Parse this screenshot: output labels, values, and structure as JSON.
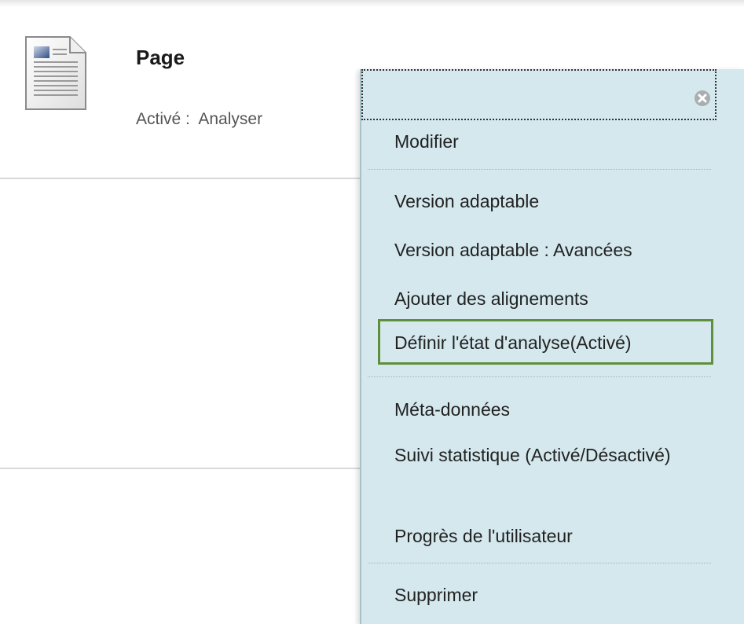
{
  "item": {
    "title": "Page",
    "status": "Activé :  Analyser",
    "icon": "document-icon"
  },
  "menu": {
    "close_icon": "close-icon",
    "items": [
      {
        "label": "Modifier"
      },
      {
        "label": "Version adaptable"
      },
      {
        "label": "Version adaptable : Avancées"
      },
      {
        "label": "Ajouter des alignements"
      },
      {
        "label": "Définir l'état d'analyse(Activé)",
        "highlighted": true
      },
      {
        "label": "Méta-données"
      },
      {
        "label": "Suivi statistique (Activé/Désactivé)"
      },
      {
        "label": "Progrès de l'utilisateur"
      },
      {
        "label": "Supprimer"
      }
    ]
  },
  "colors": {
    "menu_background": "#d4e8ee",
    "highlight_border": "#5e8f3a",
    "text": "#222222"
  }
}
